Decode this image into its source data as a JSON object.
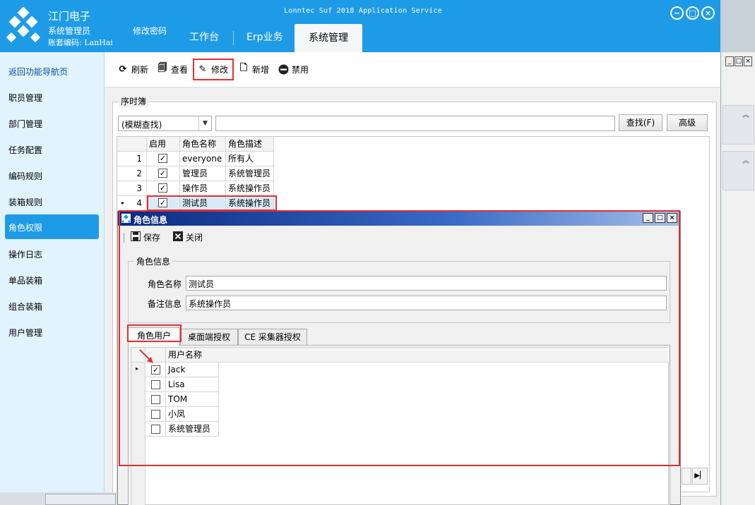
{
  "header": {
    "company": "江门电子",
    "user_role": "系统管理员",
    "account": "账套编码: LanHai",
    "change_password": "修改密码",
    "app_title": "Lonntec Suf 2018 Application Service",
    "tabs": [
      {
        "label": "工作台"
      },
      {
        "label": "Erp业务"
      },
      {
        "label": "系统管理",
        "active": true
      }
    ],
    "accent_color": "#1e9be6"
  },
  "sidebar": {
    "back_label": "返回功能导航页",
    "items": [
      {
        "label": "职员管理"
      },
      {
        "label": "部门管理"
      },
      {
        "label": "任务配置"
      },
      {
        "label": "编码规则"
      },
      {
        "label": "装箱规则"
      },
      {
        "label": "角色权限",
        "active": true
      },
      {
        "label": "操作日志"
      },
      {
        "label": "单品装箱"
      },
      {
        "label": "组合装箱"
      },
      {
        "label": "用户管理"
      }
    ]
  },
  "toolbar": {
    "refresh": "刷新",
    "view": "查看",
    "modify": "修改",
    "add": "新增",
    "disable": "禁用"
  },
  "search": {
    "group_title": "序时簿",
    "mode": "(模糊查找)",
    "query": "",
    "find_button": "查找(F)",
    "advanced_button": "高级"
  },
  "role_grid": {
    "columns": [
      "启用",
      "角色名称",
      "角色描述"
    ],
    "rows": [
      {
        "no": "1",
        "enabled": true,
        "name": "everyone",
        "desc": "所有人"
      },
      {
        "no": "2",
        "enabled": true,
        "name": "管理员",
        "desc": "系统管理员"
      },
      {
        "no": "3",
        "enabled": true,
        "name": "操作员",
        "desc": "系统操作员"
      },
      {
        "no": "4",
        "enabled": true,
        "name": "测试员",
        "desc": "系统操作员",
        "selected": true
      }
    ]
  },
  "dialog": {
    "title": "角色信息",
    "save": "保存",
    "close": "关闭",
    "fieldset_title": "角色信息",
    "role_name_label": "角色名称",
    "role_name_value": "测试员",
    "remark_label": "备注信息",
    "remark_value": "系统操作员",
    "tabs": [
      {
        "label": "角色用户",
        "active": true
      },
      {
        "label": "桌面端授权"
      },
      {
        "label": "CE 采集器授权"
      }
    ],
    "user_grid": {
      "column": "用户名称",
      "rows": [
        {
          "name": "Jack",
          "checked": true
        },
        {
          "name": "Lisa",
          "checked": false
        },
        {
          "name": "TOM",
          "checked": false
        },
        {
          "name": "小凤",
          "checked": false
        },
        {
          "name": "系统管理员",
          "checked": false
        }
      ]
    }
  }
}
